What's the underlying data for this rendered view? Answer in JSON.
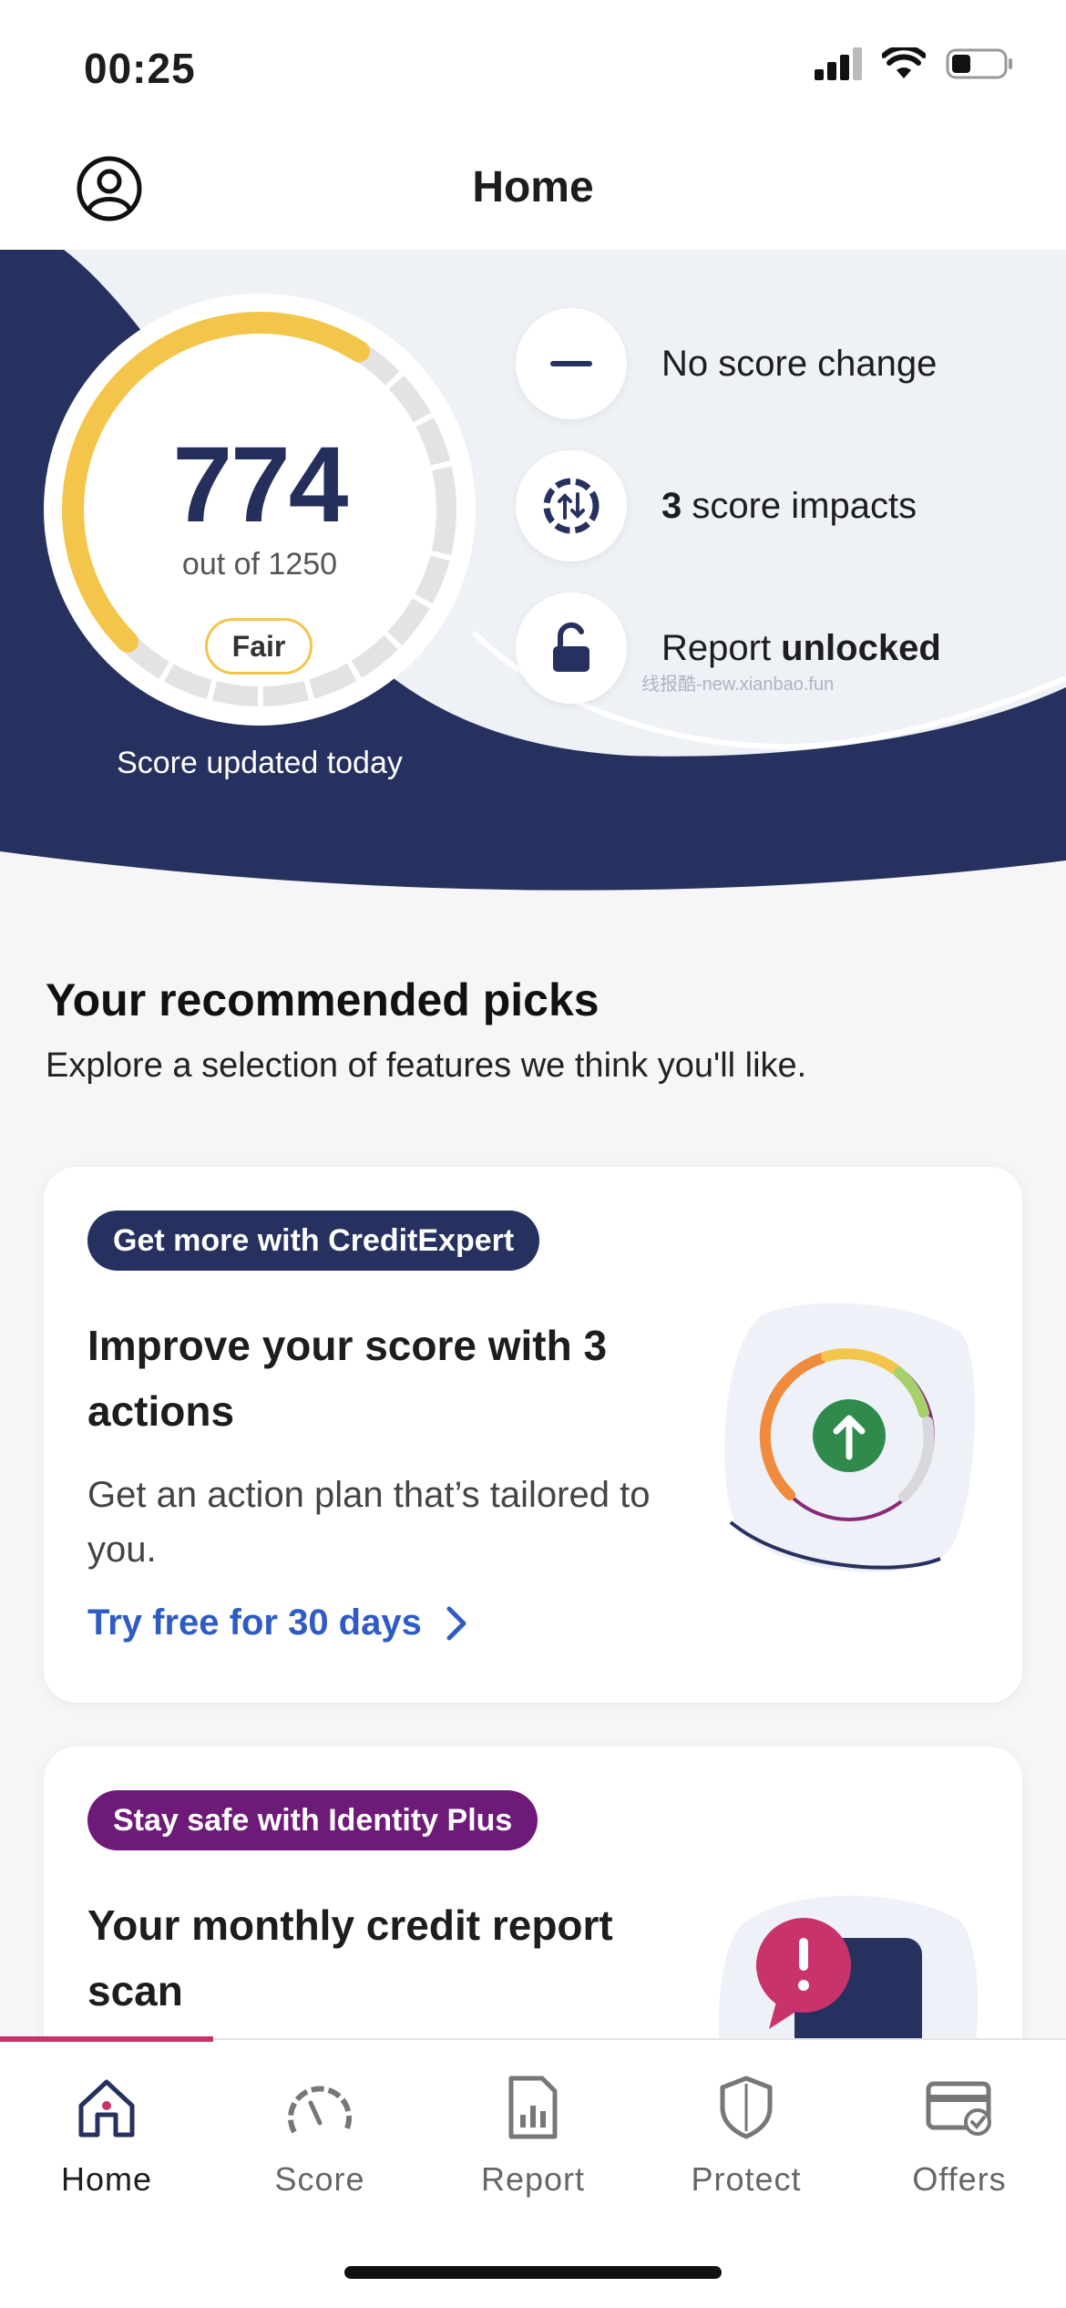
{
  "status_bar": {
    "time": "00:25"
  },
  "header": {
    "title": "Home"
  },
  "score": {
    "value": "774",
    "out_of": "out of 1250",
    "band": "Fair",
    "updated": "Score updated today",
    "fraction": 0.619
  },
  "stats": [
    {
      "icon": "minus-icon",
      "text": "No score change"
    },
    {
      "icon": "score-impacts-icon",
      "bold": "3",
      "text": " score impacts"
    },
    {
      "icon": "unlock-icon",
      "text": "Report ",
      "bold": "unlocked"
    }
  ],
  "watermark": "线报酷-new.xianbao.fun",
  "picks": {
    "title": "Your recommended picks",
    "subtitle": "Explore a selection of features we think you'll like."
  },
  "cards": [
    {
      "tag": "Get more with CreditExpert",
      "title": "Improve your score with 3 actions",
      "description": "Get an action plan that’s tailored to you.",
      "link": "Try free for 30 days"
    },
    {
      "tag": "Stay safe with Identity Plus",
      "title": "Your monthly credit report scan"
    }
  ],
  "tabs": [
    {
      "label": "Home",
      "icon": "house-icon",
      "active": true
    },
    {
      "label": "Score",
      "icon": "gauge-icon"
    },
    {
      "label": "Report",
      "icon": "report-icon"
    },
    {
      "label": "Protect",
      "icon": "shield-icon"
    },
    {
      "label": "Offers",
      "icon": "offers-card-icon"
    }
  ],
  "colors": {
    "navy": "#26315f",
    "accent_yellow": "#f3c64b",
    "link_blue": "#2f5bc4",
    "active_tab": "#c8336b"
  }
}
